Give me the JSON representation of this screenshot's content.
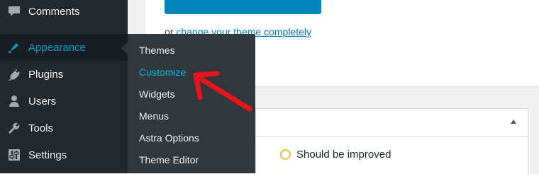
{
  "sidebar": {
    "items": [
      {
        "label": "Comments",
        "icon": "comments-icon"
      },
      {
        "label": "Appearance",
        "icon": "paintbrush-icon"
      },
      {
        "label": "Plugins",
        "icon": "plug-icon"
      },
      {
        "label": "Users",
        "icon": "user-icon"
      },
      {
        "label": "Tools",
        "icon": "wrench-icon"
      },
      {
        "label": "Settings",
        "icon": "settings-sliders-icon"
      }
    ],
    "active_item": "Appearance"
  },
  "submenu": {
    "items": [
      "Themes",
      "Customize",
      "Widgets",
      "Menus",
      "Astra Options",
      "Theme Editor"
    ],
    "current": "Customize"
  },
  "main": {
    "change_prefix": "or",
    "change_link": "change your theme completely"
  },
  "box": {
    "status_text": "Should be improved"
  },
  "colors": {
    "sidebar_bg": "#23282d",
    "submenu_bg": "#32373c",
    "accent": "#00a0d2",
    "primary_button": "#0085ba",
    "status_orange": "#f0b849",
    "annotation_red": "#e8141b"
  }
}
